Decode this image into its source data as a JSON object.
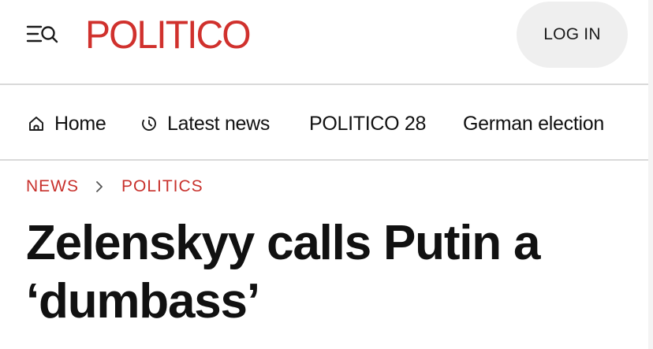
{
  "header": {
    "menu_icon": "menu-search-icon",
    "logo_text": "POLITICO",
    "login_label": "LOG IN",
    "brand_color": "#d0312d"
  },
  "nav": {
    "items": [
      {
        "label": "Home",
        "icon": "home-icon"
      },
      {
        "label": "Latest news",
        "icon": "clock-icon"
      },
      {
        "label": "POLITICO 28",
        "icon": ""
      },
      {
        "label": "German election",
        "icon": ""
      }
    ]
  },
  "breadcrumb": {
    "items": [
      "NEWS",
      "POLITICS"
    ],
    "separator_icon": "chevron-right-icon",
    "color": "#c8312c"
  },
  "article": {
    "headline": "Zelenskyy calls Putin a ‘dumbass’"
  }
}
